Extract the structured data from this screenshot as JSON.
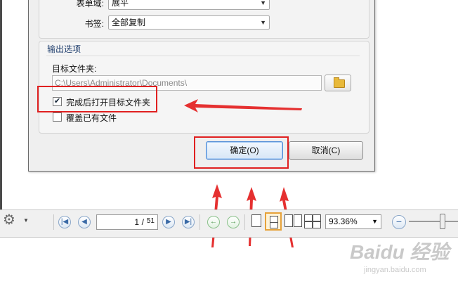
{
  "dialog": {
    "form_domain_label": "表单域:",
    "form_domain_value": "展平",
    "bookmarks_label": "书签:",
    "bookmarks_value": "全部复制",
    "output_group_title": "输出选项",
    "target_folder_label": "目标文件夹:",
    "target_folder_value": "C:\\Users\\Administrator\\Documents\\",
    "open_folder_checkbox": "完成后打开目标文件夹",
    "open_folder_checked": true,
    "overwrite_checkbox": "覆盖已有文件",
    "overwrite_checked": false,
    "ok_button": "确定(O)",
    "cancel_button": "取消(C)"
  },
  "toolbar": {
    "current_page": "1",
    "total_pages": "51",
    "zoom_value": "93.36%"
  },
  "watermark": {
    "brand": "Baidu 经验",
    "url": "jingyan.baidu.com"
  },
  "icons": {
    "settings": "gear-icon",
    "first": "first-page-icon",
    "prev": "previous-page-icon",
    "next": "next-page-icon",
    "last": "last-page-icon",
    "back": "back-icon",
    "forward": "forward-icon",
    "zoom_out": "zoom-out-icon",
    "browse": "folder-icon"
  },
  "colors": {
    "annotation": "#e02020",
    "primary_border": "#4d8ad6"
  }
}
